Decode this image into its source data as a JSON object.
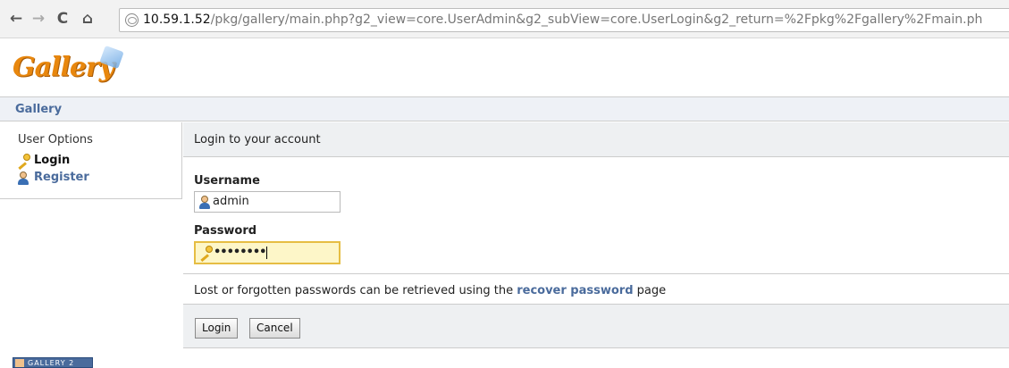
{
  "browser": {
    "back_icon": "←",
    "forward_icon": "→",
    "reload_icon": "C",
    "home_icon": "⌂",
    "url_host": "10.59.1.52",
    "url_path": "/pkg/gallery/main.php?g2_view=core.UserAdmin&g2_subView=core.UserLogin&g2_return=%2Fpkg%2Fgallery%2Fmain.ph"
  },
  "logo": {
    "text": "Gallery"
  },
  "breadcrumb": {
    "label": "Gallery"
  },
  "sidebar": {
    "title": "User Options",
    "items": [
      {
        "label": "Login",
        "icon": "key-icon"
      },
      {
        "label": "Register",
        "icon": "user-icon"
      }
    ]
  },
  "main": {
    "heading": "Login to your account",
    "username_label": "Username",
    "username_value": "admin",
    "password_label": "Password",
    "password_value": "••••••••",
    "lost_text_before": "Lost or forgotten passwords can be retrieved using the ",
    "lost_link": "recover password",
    "lost_text_after": " page",
    "login_button": "Login",
    "cancel_button": "Cancel"
  },
  "footer": {
    "badge_text": "GALLERY 2"
  },
  "colors": {
    "link": "#4a6b9c",
    "logo": "#e8870e",
    "password_focus_bg": "#fdf6c8",
    "password_focus_border": "#e6bd43"
  }
}
